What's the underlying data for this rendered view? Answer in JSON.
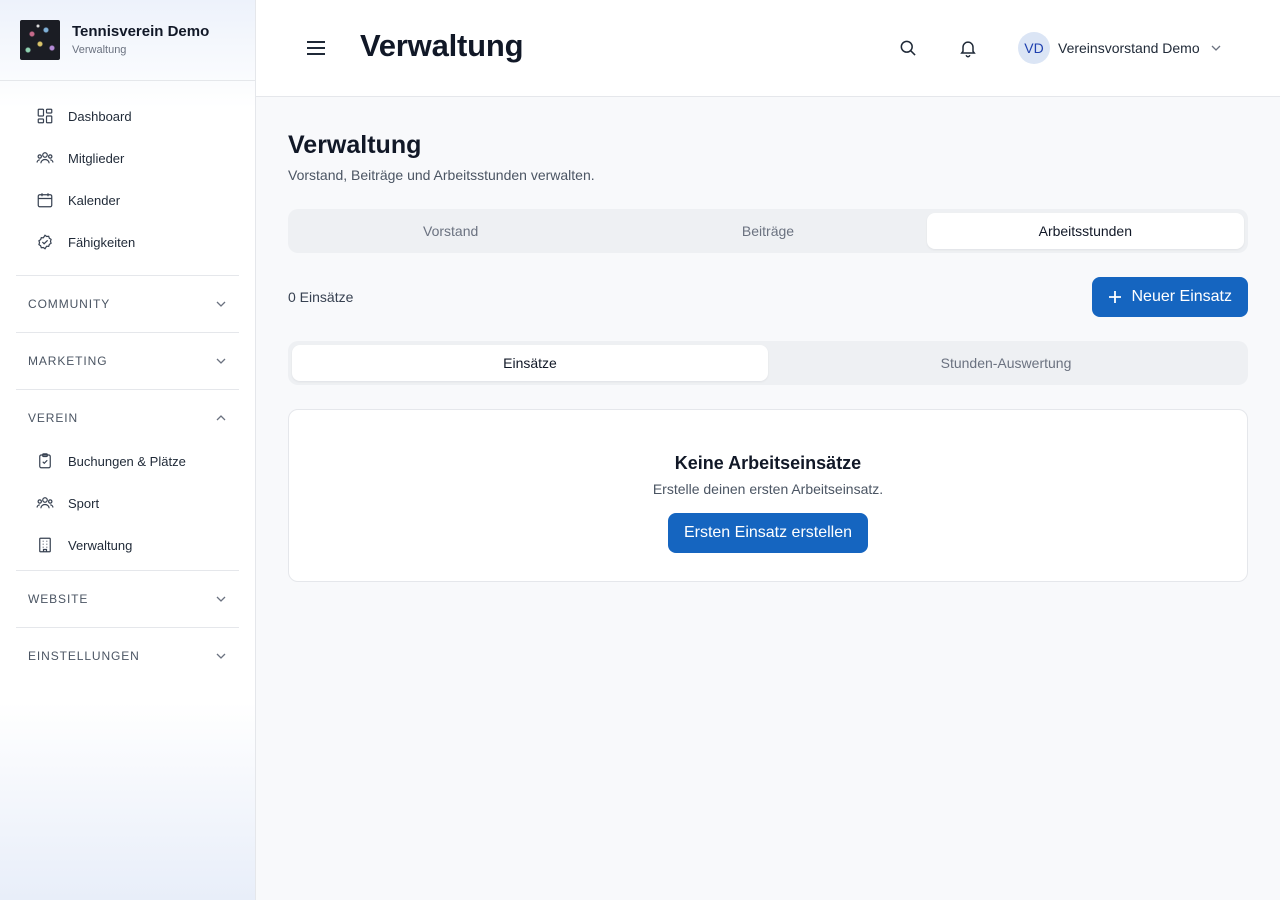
{
  "brand": {
    "title": "Tennisverein Demo",
    "subtitle": "Verwaltung"
  },
  "sidebar": {
    "items": [
      {
        "label": "Dashboard",
        "icon": "dashboard-icon"
      },
      {
        "label": "Mitglieder",
        "icon": "users-icon"
      },
      {
        "label": "Kalender",
        "icon": "calendar-icon"
      },
      {
        "label": "Fähigkeiten",
        "icon": "check-circle-icon"
      }
    ],
    "sections": [
      {
        "label": "COMMUNITY",
        "expanded": false
      },
      {
        "label": "MARKETING",
        "expanded": false
      },
      {
        "label": "VEREIN",
        "expanded": true,
        "items": [
          {
            "label": "Buchungen & Plätze",
            "icon": "clipboard-check-icon"
          },
          {
            "label": "Sport",
            "icon": "users-icon"
          },
          {
            "label": "Verwaltung",
            "icon": "building-icon"
          }
        ]
      },
      {
        "label": "WEBSITE",
        "expanded": false
      },
      {
        "label": "EINSTELLUNGEN",
        "expanded": false
      }
    ]
  },
  "header": {
    "title": "Verwaltung",
    "user": {
      "initials": "VD",
      "name": "Vereinsvorstand Demo"
    }
  },
  "main": {
    "title": "Verwaltung",
    "subtitle": "Vorstand, Beiträge und Arbeitsstunden verwalten.",
    "tabs": [
      {
        "label": "Vorstand",
        "active": false
      },
      {
        "label": "Beiträge",
        "active": false
      },
      {
        "label": "Arbeitsstunden",
        "active": true
      }
    ],
    "count": "0 Einsätze",
    "new_button": "Neuer Einsatz",
    "subtabs": [
      {
        "label": "Einsätze",
        "active": true
      },
      {
        "label": "Stunden-Auswertung",
        "active": false
      }
    ],
    "empty": {
      "title": "Keine Arbeitseinsätze",
      "subtitle": "Erstelle deinen ersten Arbeitseinsatz.",
      "button": "Ersten Einsatz erstellen"
    }
  },
  "colors": {
    "primary": "#1565c0",
    "avatar_bg": "#dbe5f5",
    "background": "#f8f9fb"
  }
}
